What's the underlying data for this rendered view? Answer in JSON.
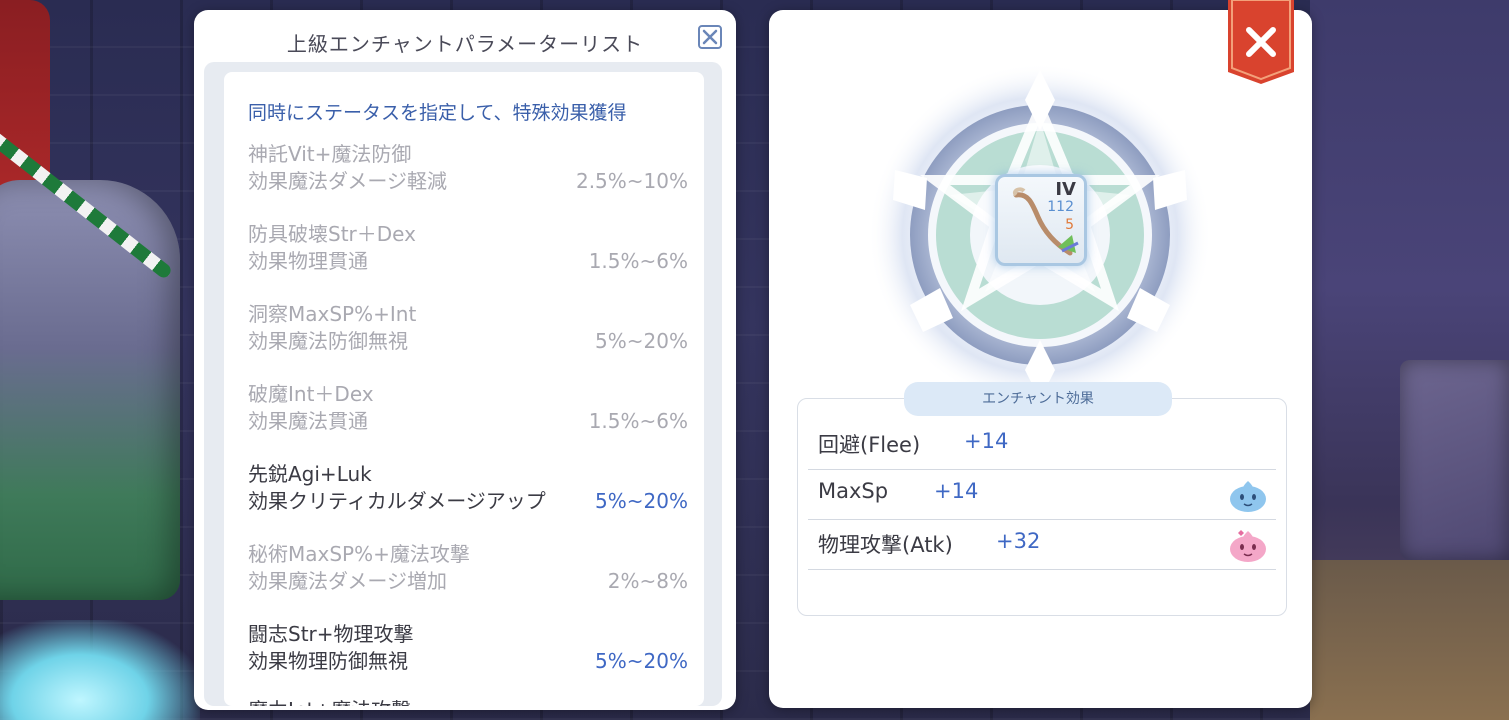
{
  "left_panel": {
    "title": "上級エンチャントパラメーターリスト",
    "close_icon": "close-x-icon",
    "header": "同時にステータスを指定して、特殊効果獲得",
    "entries": [
      {
        "name": "神託Vit+魔法防御",
        "effect": "効果魔法ダメージ軽減",
        "range": "2.5%~10%",
        "active": false
      },
      {
        "name": "防具破壊Str＋Dex",
        "effect": "効果物理貫通",
        "range": "1.5%~6%",
        "active": false
      },
      {
        "name": "洞察MaxSP%+Int",
        "effect": "効果魔法防御無視",
        "range": "5%~20%",
        "active": false
      },
      {
        "name": "破魔Int＋Dex",
        "effect": "効果魔法貫通",
        "range": "1.5%~6%",
        "active": false
      },
      {
        "name": "先鋭Agi+Luk",
        "effect": "効果クリティカルダメージアップ",
        "range": "5%~20%",
        "active": true
      },
      {
        "name": "秘術MaxSP%+魔法攻撃",
        "effect": "効果魔法ダメージ増加",
        "range": "2%~8%",
        "active": false
      },
      {
        "name": "闘志Str+物理攻撃",
        "effect": "効果物理防御無視",
        "range": "5%~20%",
        "active": true
      },
      {
        "name": "魔力Int+魔法攻撃",
        "effect": "",
        "range": "",
        "active": true
      }
    ]
  },
  "right_panel": {
    "item": {
      "tier": "IV",
      "num1": "112",
      "num2": "5",
      "icon": "bow-weapon-icon"
    },
    "effect_tab_label": "エンチャント効果",
    "stats": [
      {
        "label": "回避(Flee)",
        "value": "+14",
        "icon": ""
      },
      {
        "label": "MaxSp",
        "value": "+14",
        "icon": "blue-poring-icon"
      },
      {
        "label": "物理攻撃(Atk)",
        "value": "+32",
        "icon": "pink-poring-icon"
      }
    ],
    "close_icon": "close-x-icon"
  },
  "colors": {
    "accent_blue": "#3f68c4",
    "inactive_gray": "#a9a9b1",
    "close_red": "#d9432e"
  }
}
